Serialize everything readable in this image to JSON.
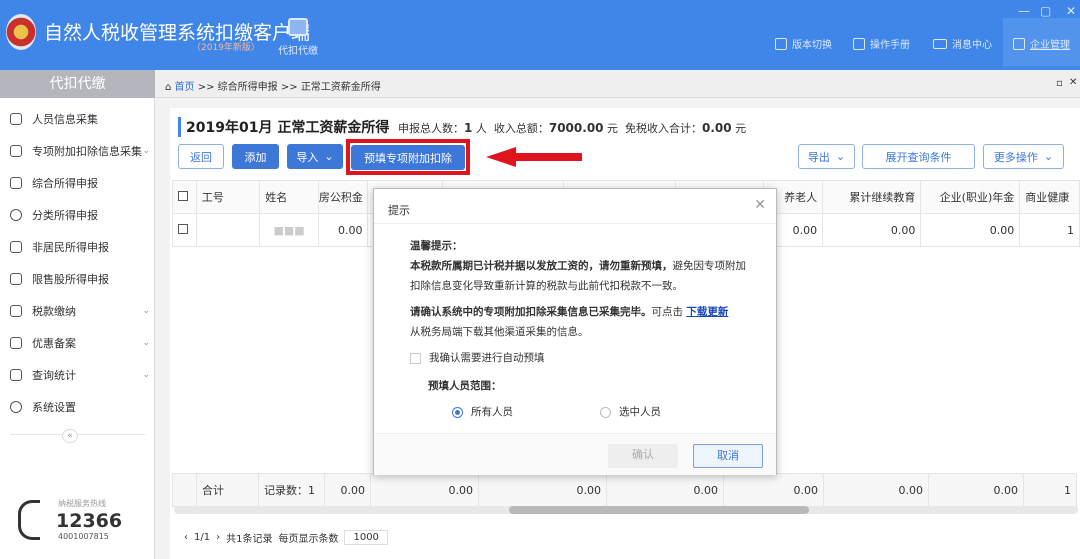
{
  "header": {
    "app_title": "自然人税收管理系统扣缴客户端",
    "version": "（2019年新版）",
    "module": "代扣代缴",
    "buttons": [
      {
        "label": "版本切换",
        "icon": "document-icon"
      },
      {
        "label": "操作手册",
        "icon": "document-icon"
      },
      {
        "label": "消息中心",
        "icon": "mail-icon"
      },
      {
        "label": "企业管理",
        "icon": "building-icon"
      }
    ],
    "window_controls": [
      "—",
      "▢",
      "✕"
    ],
    "brand_color": "#3f86e8"
  },
  "breadcrumb": {
    "home": "首页",
    "sep": ">>",
    "items": [
      "综合所得申报",
      "正常工资薪金所得"
    ]
  },
  "sidebar": {
    "title": "代扣代缴",
    "items": [
      {
        "label": "人员信息采集",
        "icon": "user-icon",
        "expandable": false
      },
      {
        "label": "专项附加扣除信息采集",
        "icon": "list-icon",
        "expandable": true
      },
      {
        "label": "综合所得申报",
        "icon": "layers-icon",
        "expandable": false
      },
      {
        "label": "分类所得申报",
        "icon": "pie-icon",
        "expandable": false
      },
      {
        "label": "非居民所得申报",
        "icon": "person-icon",
        "expandable": false
      },
      {
        "label": "限售股所得申报",
        "icon": "bar-chart-icon",
        "expandable": false
      },
      {
        "label": "税款缴纳",
        "icon": "folder-icon",
        "expandable": true
      },
      {
        "label": "优惠备案",
        "icon": "book-icon",
        "expandable": true
      },
      {
        "label": "查询统计",
        "icon": "search-list-icon",
        "expandable": true
      },
      {
        "label": "系统设置",
        "icon": "gear-icon",
        "expandable": false
      }
    ],
    "collapse": "«",
    "hotline": {
      "label": "纳税服务热线",
      "number": "12366",
      "sub": "4001007815"
    }
  },
  "main": {
    "title": "2019年01月 正常工资薪金所得",
    "summary": {
      "count_label": "申报总人数：",
      "count": "1",
      "count_unit": "人",
      "income_label": "收入总额：",
      "income": "7000.00",
      "income_unit": "元",
      "exempt_label": "免税收入合计：",
      "exempt": "0.00",
      "exempt_unit": "元"
    },
    "toolbar": {
      "back": "返回",
      "add": "添加",
      "import": "导入",
      "prefill": "预填专项附加扣除",
      "export": "导出",
      "expand_query": "展开查询条件",
      "more": "更多操作"
    },
    "table": {
      "headers": [
        "",
        "工号",
        "姓名",
        "房公积金",
        "",
        "",
        "",
        "",
        "养老人",
        "累计继续教育",
        "企业(职业)年金",
        "商业健康"
      ],
      "rows": [
        [
          "",
          "",
          "■■■",
          "0.00",
          "",
          "",
          "",
          "",
          "0.00",
          "0.00",
          "0.00",
          "1"
        ]
      ],
      "footer": [
        "合计",
        "记录数：1",
        "0.00",
        "0.00",
        "0.00",
        "0.00",
        "0.00",
        "0.00",
        "0.00",
        "1"
      ]
    },
    "pager": {
      "page": "1/1",
      "total": "共1条记录",
      "per_page_label": "每页显示条数",
      "per_page": "1000"
    }
  },
  "dialog": {
    "title": "提示",
    "close": "✕",
    "heading": "温馨提示：",
    "p1_bold": "本税款所属期已计税并据以发放工资的，请勿重新预填，",
    "p1_rest": "避免因专项附加扣除信息变化导致重新计算的税款与此前代扣税款不一致。",
    "p2_bold": "请确认系统中的专项附加扣除采集信息已采集完毕。",
    "p2_mid": "可点击 ",
    "p2_link": "下载更新",
    "p2_rest": "从税务局端下载其他渠道采集的信息。",
    "confirm_checkbox": "我确认需要进行自动预填",
    "confirm_checked": false,
    "scope_label": "预填人员范围：",
    "scope_options": [
      "所有人员",
      "选中人员"
    ],
    "scope_selected": "所有人员",
    "ok": "确认",
    "cancel": "取消"
  }
}
